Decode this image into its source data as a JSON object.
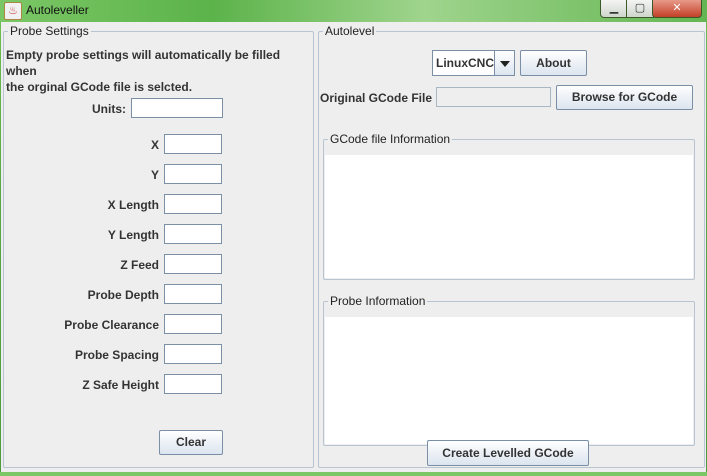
{
  "window": {
    "title": "Autoleveller",
    "app_icon": "java-cup-icon",
    "controls": {
      "minimize": "minimize-icon",
      "maximize": "maximize-icon",
      "close": "close-icon"
    }
  },
  "probe_settings": {
    "legend": "Probe Settings",
    "description_line1": "Empty probe settings will automatically be filled when",
    "description_line2": "the orginal GCode file is selcted.",
    "fields": {
      "units": {
        "label": "Units:",
        "value": ""
      },
      "x": {
        "label": "X",
        "value": ""
      },
      "y": {
        "label": "Y",
        "value": ""
      },
      "x_length": {
        "label": "X Length",
        "value": ""
      },
      "y_length": {
        "label": "Y Length",
        "value": ""
      },
      "z_feed": {
        "label": "Z Feed",
        "value": ""
      },
      "probe_depth": {
        "label": "Probe Depth",
        "value": ""
      },
      "probe_clearance": {
        "label": "Probe Clearance",
        "value": ""
      },
      "probe_spacing": {
        "label": "Probe Spacing",
        "value": ""
      },
      "z_safe_height": {
        "label": "Z Safe Height",
        "value": ""
      }
    },
    "clear_label": "Clear"
  },
  "autolevel": {
    "legend": "Autolevel",
    "controller": {
      "selected": "LinuxCNC"
    },
    "about_label": "About",
    "original_gcode_label": "Original GCode File",
    "original_gcode_value": "",
    "browse_label": "Browse for GCode",
    "gcode_info_legend": "GCode file Information",
    "probe_info_legend": "Probe Information",
    "create_label": "Create Levelled GCode"
  }
}
